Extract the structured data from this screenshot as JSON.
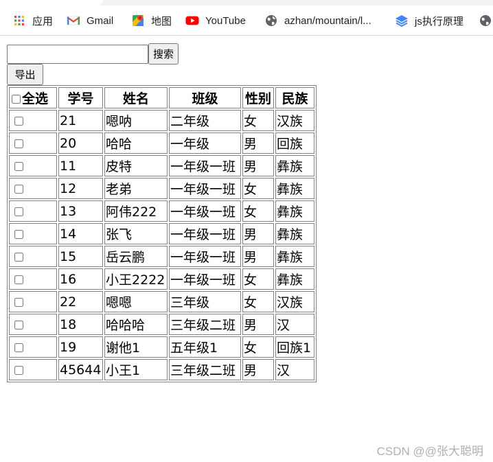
{
  "bookmarks": {
    "items": [
      {
        "label": "应用",
        "icon": "apps-grid-icon"
      },
      {
        "label": "Gmail",
        "icon": "gmail-icon"
      },
      {
        "label": "地图",
        "icon": "maps-icon"
      },
      {
        "label": "YouTube",
        "icon": "youtube-icon"
      },
      {
        "label": "azhan/mountain/l...",
        "icon": "globe-icon"
      },
      {
        "label": "js执行原理",
        "icon": "layers-icon"
      }
    ]
  },
  "toolbar": {
    "search_value": "",
    "search_button": "搜索",
    "export_button": "导出"
  },
  "table": {
    "headers": {
      "select_all": "全选",
      "id": "学号",
      "name": "姓名",
      "class": "班级",
      "sex": "性别",
      "ethnicity": "民族"
    },
    "rows": [
      {
        "id": "21",
        "name": "嗯呐",
        "class": "二年级",
        "sex": "女",
        "ethnicity": "汉族"
      },
      {
        "id": "20",
        "name": "哈哈",
        "class": "一年级",
        "sex": "男",
        "ethnicity": "回族"
      },
      {
        "id": "11",
        "name": "皮特",
        "class": "一年级一班",
        "sex": "男",
        "ethnicity": "彝族"
      },
      {
        "id": "12",
        "name": "老弟",
        "class": "一年级一班",
        "sex": "女",
        "ethnicity": "彝族"
      },
      {
        "id": "13",
        "name": "阿伟222",
        "class": "一年级一班",
        "sex": "女",
        "ethnicity": "彝族"
      },
      {
        "id": "14",
        "name": "张飞",
        "class": "一年级一班",
        "sex": "男",
        "ethnicity": "彝族"
      },
      {
        "id": "15",
        "name": "岳云鹏",
        "class": "一年级一班",
        "sex": "男",
        "ethnicity": "彝族"
      },
      {
        "id": "16",
        "name": "小王2222",
        "class": "一年级一班",
        "sex": "女",
        "ethnicity": "彝族"
      },
      {
        "id": "22",
        "name": "嗯嗯",
        "class": "三年级",
        "sex": "女",
        "ethnicity": "汉族"
      },
      {
        "id": "18",
        "name": "哈哈哈",
        "class": "三年级二班",
        "sex": "男",
        "ethnicity": "汉"
      },
      {
        "id": "19",
        "name": "谢他1",
        "class": "五年级1",
        "sex": "女",
        "ethnicity": "回族1"
      },
      {
        "id": "45644",
        "name": "小王1",
        "class": "三年级二班",
        "sex": "男",
        "ethnicity": "汉"
      }
    ]
  },
  "watermark": "CSDN @@张大聪明",
  "colors": {
    "youtube_red": "#ff0000",
    "gmail_red": "#ea4335",
    "js_blue": "#4285f4"
  }
}
